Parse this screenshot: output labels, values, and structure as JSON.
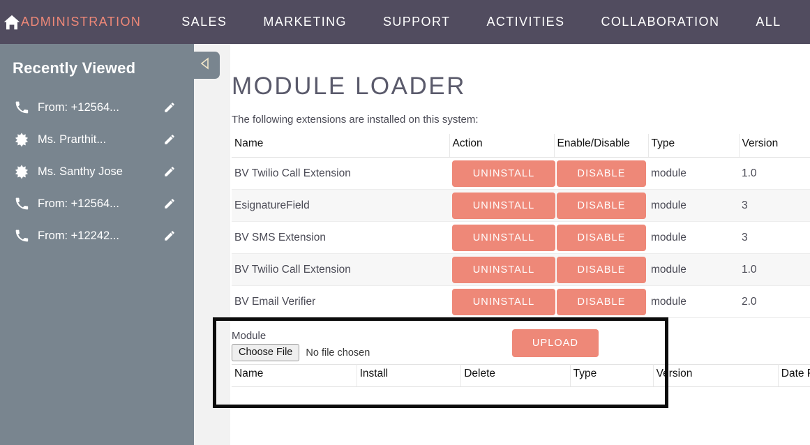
{
  "topnav": {
    "home_icon": "home-icon",
    "items": [
      {
        "label": "ADMINISTRATION",
        "active": true
      },
      {
        "label": "SALES",
        "active": false
      },
      {
        "label": "MARKETING",
        "active": false
      },
      {
        "label": "SUPPORT",
        "active": false
      },
      {
        "label": "ACTIVITIES",
        "active": false
      },
      {
        "label": "COLLABORATION",
        "active": false
      },
      {
        "label": "ALL",
        "active": false
      }
    ],
    "background_color": "#514C5F",
    "active_color": "#EE8878"
  },
  "sidebar": {
    "title": "Recently Viewed",
    "background_color": "#79858F",
    "collapse_icon": "triangle-left-icon",
    "items": [
      {
        "icon": "phone-icon",
        "label": "From: +12564...",
        "edit_icon": "pencil-icon"
      },
      {
        "icon": "starburst-icon",
        "label": "Ms. Prarthit...",
        "edit_icon": "pencil-icon"
      },
      {
        "icon": "starburst-icon",
        "label": "Ms. Santhy Jose",
        "edit_icon": "pencil-icon"
      },
      {
        "icon": "phone-icon",
        "label": "From: +12564...",
        "edit_icon": "pencil-icon"
      },
      {
        "icon": "phone-icon",
        "label": "From: +12242...",
        "edit_icon": "pencil-icon"
      }
    ]
  },
  "main": {
    "page_title": "MODULE LOADER",
    "subtitle": "The following extensions are installed on this system:",
    "extensions_table": {
      "headers": [
        "Name",
        "Action",
        "Enable/Disable",
        "Type",
        "Version",
        ""
      ],
      "rows": [
        {
          "name": "BV Twilio Call Extension",
          "action": "UNINSTALL",
          "enable_disable": "DISABLE",
          "type": "module",
          "version": "1.0"
        },
        {
          "name": "EsignatureField",
          "action": "UNINSTALL",
          "enable_disable": "DISABLE",
          "type": "module",
          "version": "3"
        },
        {
          "name": "BV SMS Extension",
          "action": "UNINSTALL",
          "enable_disable": "DISABLE",
          "type": "module",
          "version": "3"
        },
        {
          "name": "BV Twilio Call Extension",
          "action": "UNINSTALL",
          "enable_disable": "DISABLE",
          "type": "module",
          "version": "1.0"
        },
        {
          "name": "BV Email Verifier",
          "action": "UNINSTALL",
          "enable_disable": "DISABLE",
          "type": "module",
          "version": "2.0"
        }
      ]
    },
    "scrollbar": {
      "name": "horizontal-scrollbar",
      "color": "#9DD5C0"
    },
    "upload_section": {
      "module_label": "Module",
      "choose_file_label": "Choose File",
      "no_file_text": "No file chosen",
      "upload_button": "UPLOAD",
      "table_headers": [
        "Name",
        "Install",
        "Delete",
        "Type",
        "Version",
        "Date Published"
      ],
      "highlight_color": "#0C0C0C"
    },
    "accent_button_color": "#EE8878"
  }
}
